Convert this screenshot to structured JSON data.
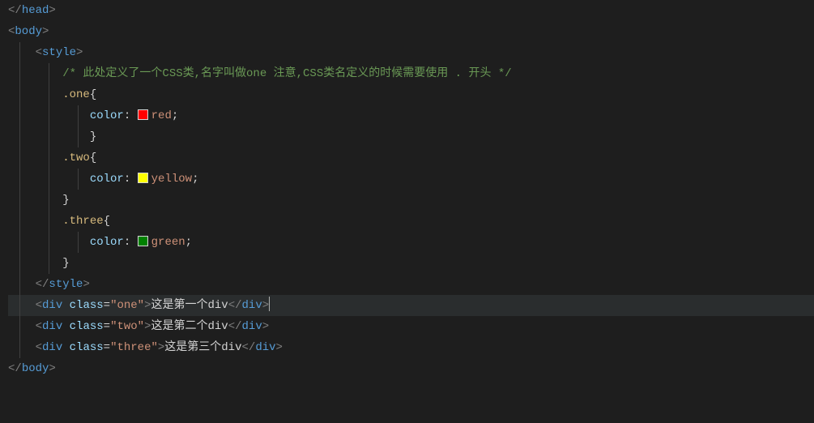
{
  "code": {
    "line1": {
      "tag": "head"
    },
    "line2": {
      "tag": "body"
    },
    "line3": {
      "tag": "style"
    },
    "line4": {
      "comment": "/* 此处定义了一个CSS类,名字叫做one 注意,CSS类名定义的时候需要使用 . 开头 */"
    },
    "line5": {
      "selector": ".one",
      "brace": "{"
    },
    "line6": {
      "property": "color",
      "colon": ":",
      "swatch": "red",
      "value": "red",
      "semi": ";"
    },
    "line7": {
      "brace": "}"
    },
    "line8": {
      "selector": ".two",
      "brace": "{"
    },
    "line9": {
      "property": "color",
      "colon": ":",
      "swatch": "yellow",
      "value": "yellow",
      "semi": ";"
    },
    "line10": {
      "brace": "}"
    },
    "line11": {
      "selector": ".three",
      "brace": "{"
    },
    "line12": {
      "property": "color",
      "colon": ":",
      "swatch": "green",
      "value": "green",
      "semi": ";"
    },
    "line13": {
      "brace": "}"
    },
    "line14": {
      "tag": "style"
    },
    "line15": {
      "tag": "div",
      "attrname": "class",
      "attrvalue": "\"one\"",
      "text": "这是第一个div"
    },
    "line16": {
      "tag": "div",
      "attrname": "class",
      "attrvalue": "\"two\"",
      "text": "这是第二个div"
    },
    "line17": {
      "tag": "div",
      "attrname": "class",
      "attrvalue": "\"three\"",
      "text": "这是第三个div"
    },
    "line18": {
      "tag": "body"
    }
  }
}
